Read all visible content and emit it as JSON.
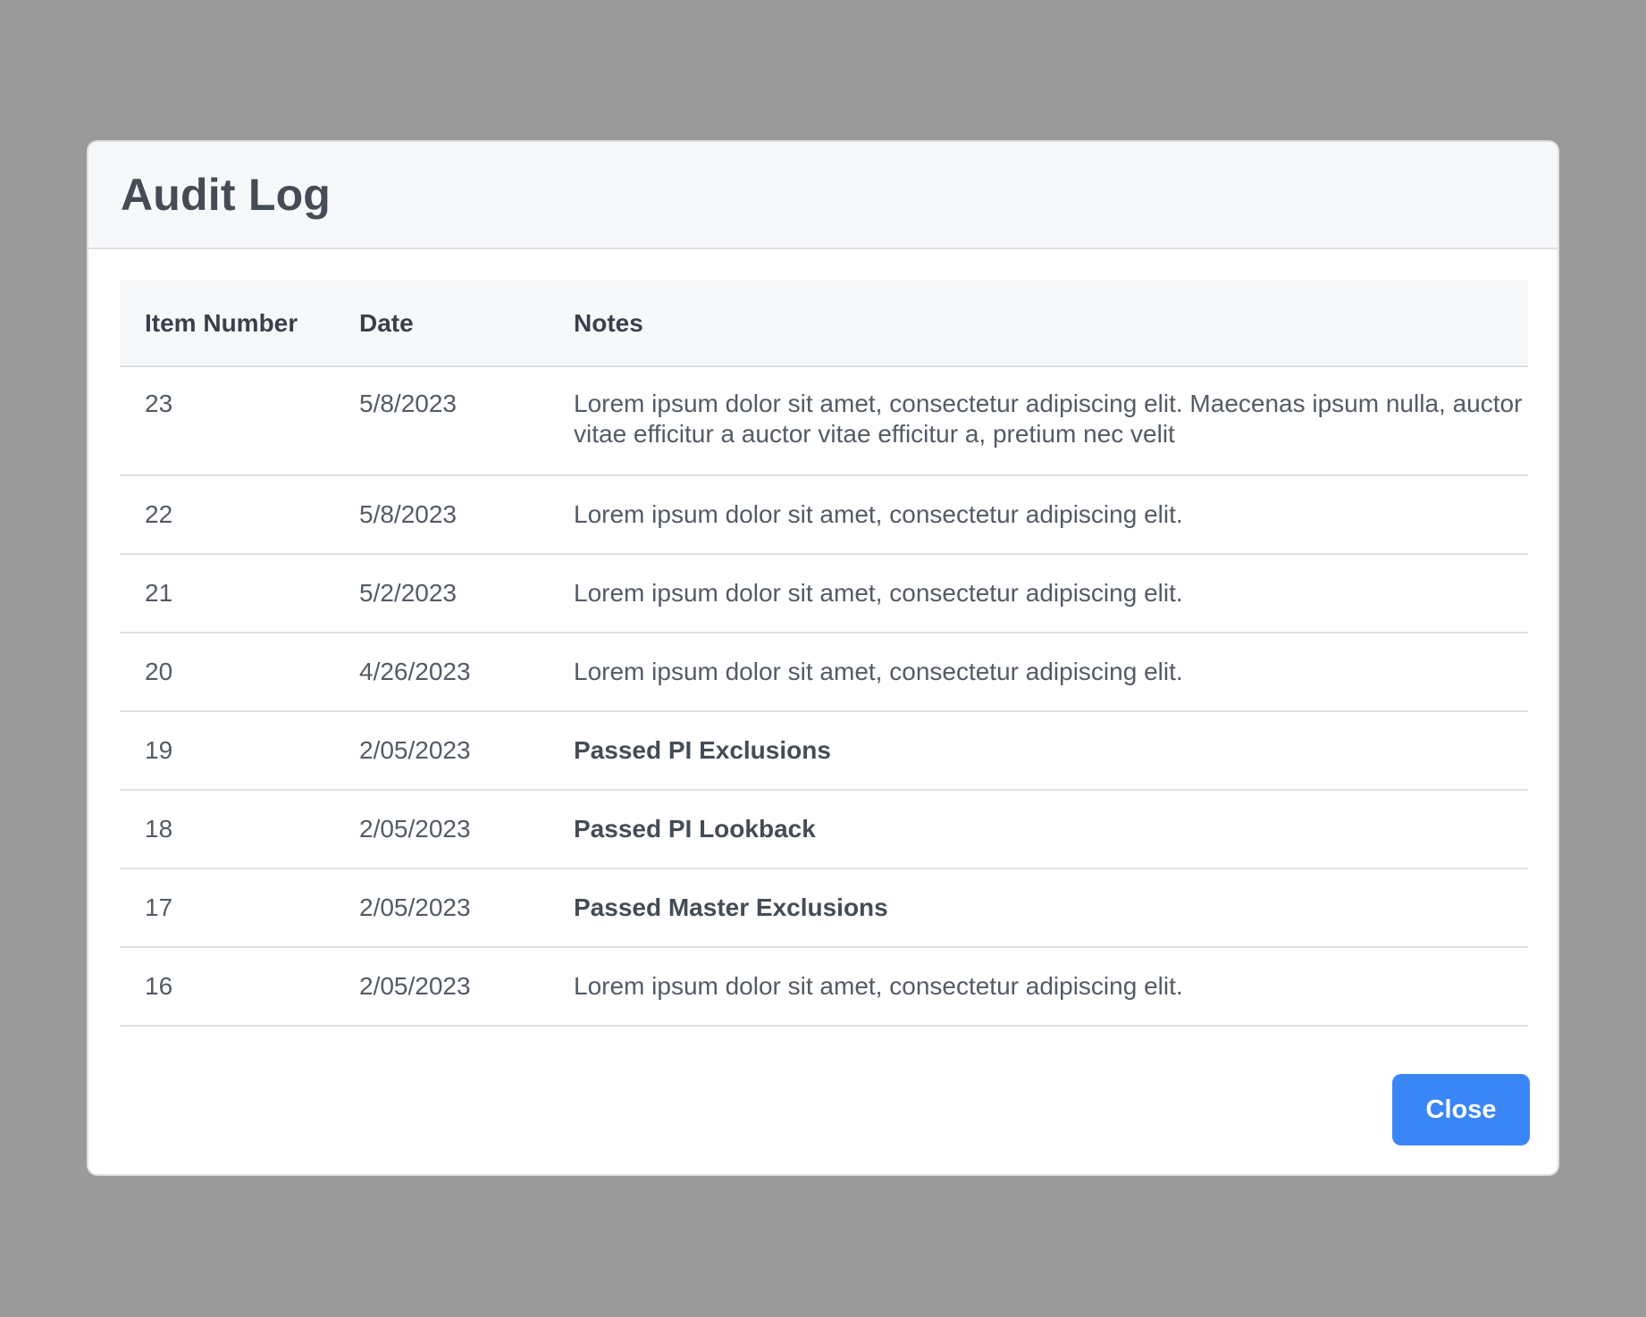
{
  "modal": {
    "title": "Audit Log",
    "close_label": "Close"
  },
  "table": {
    "headers": {
      "item_number": "Item Number",
      "date": "Date",
      "notes": "Notes"
    },
    "rows": [
      {
        "item": "23",
        "date": "5/8/2023",
        "notes": "Lorem ipsum dolor sit amet, consectetur adipiscing elit. Maecenas ipsum nulla, auctor vitae efficitur a auctor vitae efficitur a, pretium nec velit",
        "bold": false
      },
      {
        "item": "22",
        "date": "5/8/2023",
        "notes": "Lorem ipsum dolor sit amet, consectetur adipiscing elit.",
        "bold": false
      },
      {
        "item": "21",
        "date": "5/2/2023",
        "notes": "Lorem ipsum dolor sit amet, consectetur adipiscing elit.",
        "bold": false
      },
      {
        "item": "20",
        "date": "4/26/2023",
        "notes": "Lorem ipsum dolor sit amet, consectetur adipiscing elit.",
        "bold": false
      },
      {
        "item": "19",
        "date": "2/05/2023",
        "notes": "Passed PI Exclusions",
        "bold": true
      },
      {
        "item": "18",
        "date": "2/05/2023",
        "notes": "Passed PI Lookback",
        "bold": true
      },
      {
        "item": "17",
        "date": "2/05/2023",
        "notes": "Passed Master Exclusions",
        "bold": true
      },
      {
        "item": "16",
        "date": "2/05/2023",
        "notes": "Lorem ipsum dolor sit amet, consectetur adipiscing elit.",
        "bold": false
      }
    ]
  },
  "colors": {
    "backdrop": "#9a9a9a",
    "primary_button": "#3b86f7",
    "header_bg": "#f7f8fa"
  }
}
